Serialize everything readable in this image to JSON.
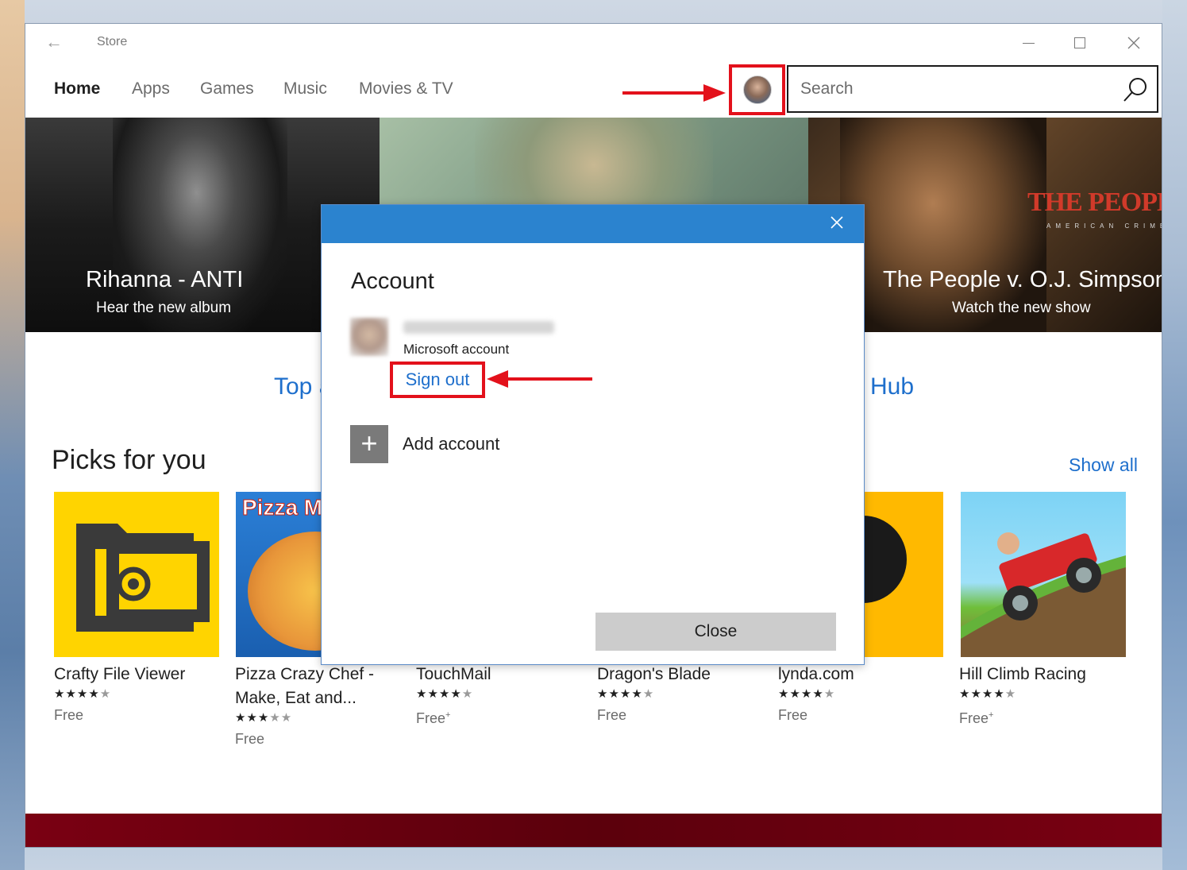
{
  "window": {
    "title": "Store"
  },
  "nav": {
    "items": [
      "Home",
      "Apps",
      "Games",
      "Music",
      "Movies & TV"
    ],
    "active": "Home"
  },
  "search": {
    "placeholder": "Search"
  },
  "hero": [
    {
      "title": "Rihanna - ANTI",
      "subtitle": "Hear the new album"
    },
    {
      "title": "",
      "subtitle": ""
    },
    {
      "title": "The People v. O.J. Simpson",
      "subtitle": "Watch the new show",
      "logo": "THE PEOPLE v. O.J. S",
      "logo_tagline": "AMERICAN CRIME"
    }
  ],
  "section_links": {
    "left": "Top a",
    "right": "Hub"
  },
  "picks": {
    "title": "Picks for you",
    "show_all": "Show all",
    "tiles": [
      {
        "name": "Crafty File Viewer",
        "stars": "★★★★",
        "stars_dim": "★",
        "price": "Free",
        "plus": false
      },
      {
        "name": "Pizza Crazy Chef - Make, Eat and...",
        "stars": "★★★",
        "stars_dim": "★★",
        "price": "Free",
        "plus": false
      },
      {
        "name": "TouchMail",
        "stars": "★★★★",
        "stars_dim": "★",
        "price": "Free",
        "plus": true
      },
      {
        "name": "Dragon's Blade",
        "stars": "★★★★",
        "stars_dim": "★",
        "price": "Free",
        "plus": false
      },
      {
        "name": "lynda.com",
        "stars": "★★★★",
        "stars_dim": "★",
        "price": "Free",
        "plus": false
      },
      {
        "name": "Hill Climb Racing",
        "stars": "★★★★",
        "stars_dim": "★",
        "price": "Free",
        "plus": true
      }
    ],
    "tile2_logo": "Pizza M"
  },
  "dialog": {
    "title": "Account",
    "account_type": "Microsoft account",
    "sign_out": "Sign out",
    "add_account": "Add account",
    "close": "Close"
  },
  "colors": {
    "accent": "#2b83cf",
    "link": "#1e6fcc",
    "highlight": "#e3111b"
  }
}
